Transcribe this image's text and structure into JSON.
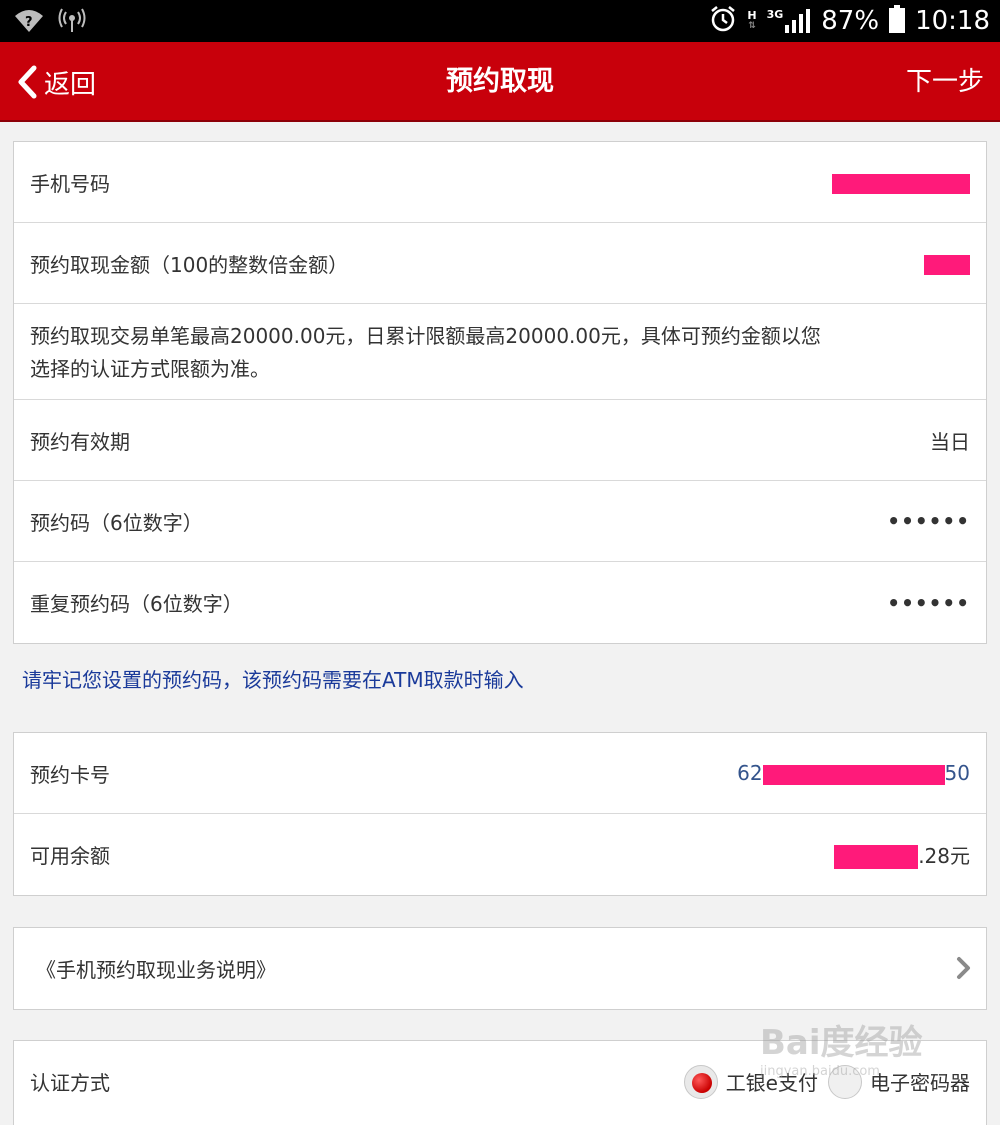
{
  "status_bar": {
    "battery": "87%",
    "time": "10:18",
    "network_h": "H",
    "network_3g": "3G"
  },
  "header": {
    "back_label": "返回",
    "title": "预约取现",
    "next_label": "下一步"
  },
  "form": {
    "phone_label": "手机号码",
    "amount_label": "预约取现金额（100的整数倍金额）",
    "limit_desc_line1": "预约取现交易单笔最高20000.00元，日累计限额最高20000.00元，具体可预约金额以您",
    "limit_desc_line2": "选择的认证方式限额为准。",
    "validity_label": "预约有效期",
    "validity_value": "当日",
    "code_label": "预约码（6位数字）",
    "code_value": "••••••",
    "code_repeat_label": "重复预约码（6位数字）",
    "code_repeat_value": "••••••"
  },
  "note": "请牢记您设置的预约码，该预约码需要在ATM取款时输入",
  "account": {
    "card_label": "预约卡号",
    "card_prefix": "62",
    "card_suffix": "50",
    "balance_label": "可用余额",
    "balance_suffix": ".28元"
  },
  "agreement": {
    "link_label": "《手机预约取现业务说明》"
  },
  "auth": {
    "label": "认证方式",
    "options": [
      "工银e支付",
      "电子密码器"
    ],
    "selected": "工银e支付"
  },
  "watermark": {
    "text": "Bai度经验",
    "sub": "jingyan.baidu.com"
  },
  "colors": {
    "header_bg": "#c8000b",
    "link_blue": "#1a3a9a",
    "value_blue": "#34548c",
    "redaction": "#ff1a7a"
  }
}
